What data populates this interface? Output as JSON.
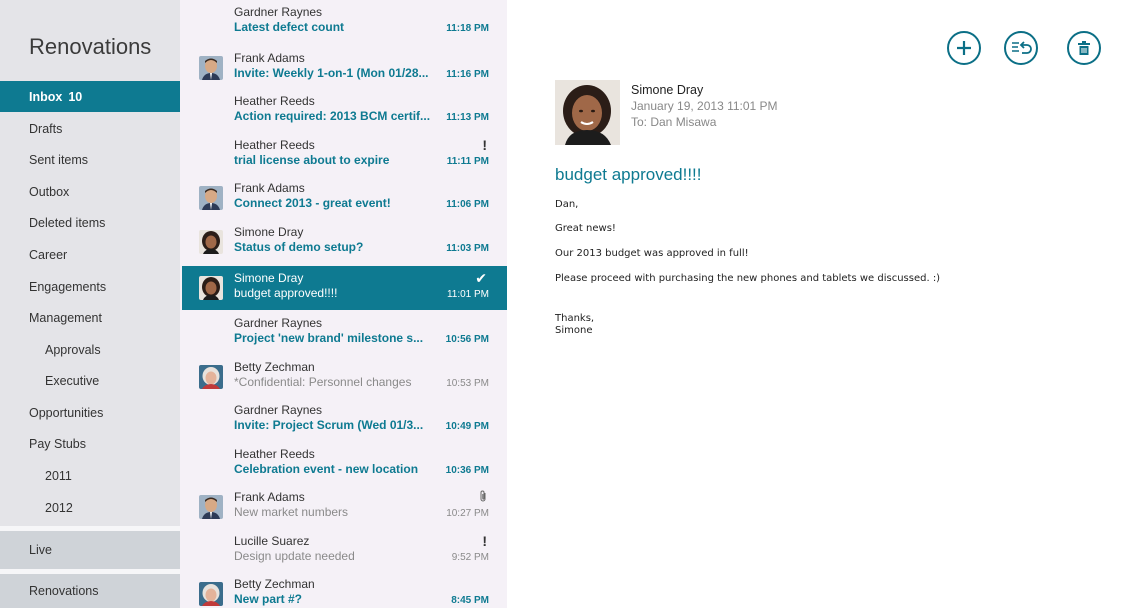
{
  "account_title": "Renovations",
  "folders": [
    {
      "label": "Inbox",
      "count": "10",
      "active": true
    },
    {
      "label": "Drafts"
    },
    {
      "label": "Sent items"
    },
    {
      "label": "Outbox"
    },
    {
      "label": "Deleted items"
    },
    {
      "label": "Career"
    },
    {
      "label": "Engagements"
    },
    {
      "label": "Management"
    },
    {
      "label": "Approvals",
      "sub": true
    },
    {
      "label": "Executive",
      "sub": true
    },
    {
      "label": "Opportunities"
    },
    {
      "label": "Pay Stubs"
    },
    {
      "label": "2011",
      "sub": true
    },
    {
      "label": "2012",
      "sub": true
    }
  ],
  "accounts": [
    {
      "label": "Live"
    },
    {
      "label": "Renovations"
    }
  ],
  "messages": [
    {
      "sender": "Gardner Raynes",
      "subject": "Latest defect count",
      "time": "11:18 PM",
      "unread": true,
      "avatar": "none"
    },
    {
      "sender": "Frank Adams",
      "subject": "Invite: Weekly 1-on-1 (Mon 01/28...",
      "time": "11:16 PM",
      "unread": true,
      "avatar": "frank"
    },
    {
      "sender": "Heather Reeds",
      "subject": "Action required: 2013 BCM certif...",
      "time": "11:13 PM",
      "unread": true,
      "avatar": "none"
    },
    {
      "sender": "Heather Reeds",
      "subject": "trial license about to expire",
      "time": "11:11 PM",
      "unread": true,
      "avatar": "none",
      "flag": "!"
    },
    {
      "sender": "Frank Adams",
      "subject": "Connect 2013 - great event!",
      "time": "11:06 PM",
      "unread": true,
      "avatar": "frank"
    },
    {
      "sender": "Simone Dray",
      "subject": "Status of demo setup?",
      "time": "11:03 PM",
      "unread": true,
      "avatar": "simone"
    },
    {
      "sender": "Simone Dray",
      "subject": "budget approved!!!!",
      "time": "11:01 PM",
      "unread": false,
      "avatar": "simone",
      "selected": true,
      "flag": "✔"
    },
    {
      "sender": "Gardner Raynes",
      "subject": "Project 'new brand' milestone s...",
      "time": "10:56 PM",
      "unread": true,
      "avatar": "none"
    },
    {
      "sender": "Betty Zechman",
      "subject": "*Confidential: Personnel changes",
      "time": "10:53 PM",
      "unread": false,
      "avatar": "betty"
    },
    {
      "sender": "Gardner Raynes",
      "subject": "Invite: Project Scrum (Wed 01/3...",
      "time": "10:49 PM",
      "unread": true,
      "avatar": "none"
    },
    {
      "sender": "Heather Reeds",
      "subject": "Celebration event - new location",
      "time": "10:36 PM",
      "unread": true,
      "avatar": "none"
    },
    {
      "sender": "Frank Adams",
      "subject": "New market numbers",
      "time": "10:27 PM",
      "unread": false,
      "avatar": "frank",
      "flag": "paperclip"
    },
    {
      "sender": "Lucille Suarez",
      "subject": "Design update needed",
      "time": "9:52 PM",
      "unread": false,
      "avatar": "none",
      "flag": "!"
    },
    {
      "sender": "Betty Zechman",
      "subject": "New part #?",
      "time": "8:45 PM",
      "unread": true,
      "avatar": "betty"
    }
  ],
  "reading": {
    "from_name": "Simone Dray",
    "date": "January 19, 2013  11:01 PM",
    "to": "To: Dan Misawa",
    "subject": "budget approved!!!!",
    "body": [
      "Dan,",
      "Great news!",
      "Our 2013 budget was approved in full!",
      "Please proceed with purchasing the new phones and tablets we discussed.  :)",
      "Thanks,",
      "Simone"
    ]
  },
  "commands": [
    {
      "name": "new-mail",
      "icon": "plus-icon"
    },
    {
      "name": "respond",
      "icon": "reply-icon"
    },
    {
      "name": "delete",
      "icon": "trash-icon"
    }
  ],
  "colors": {
    "accent": "#0e7a91",
    "folder_bg": "#e4e4e8",
    "list_bg": "#f5f1f7",
    "account_bg": "#cfd3d8"
  }
}
